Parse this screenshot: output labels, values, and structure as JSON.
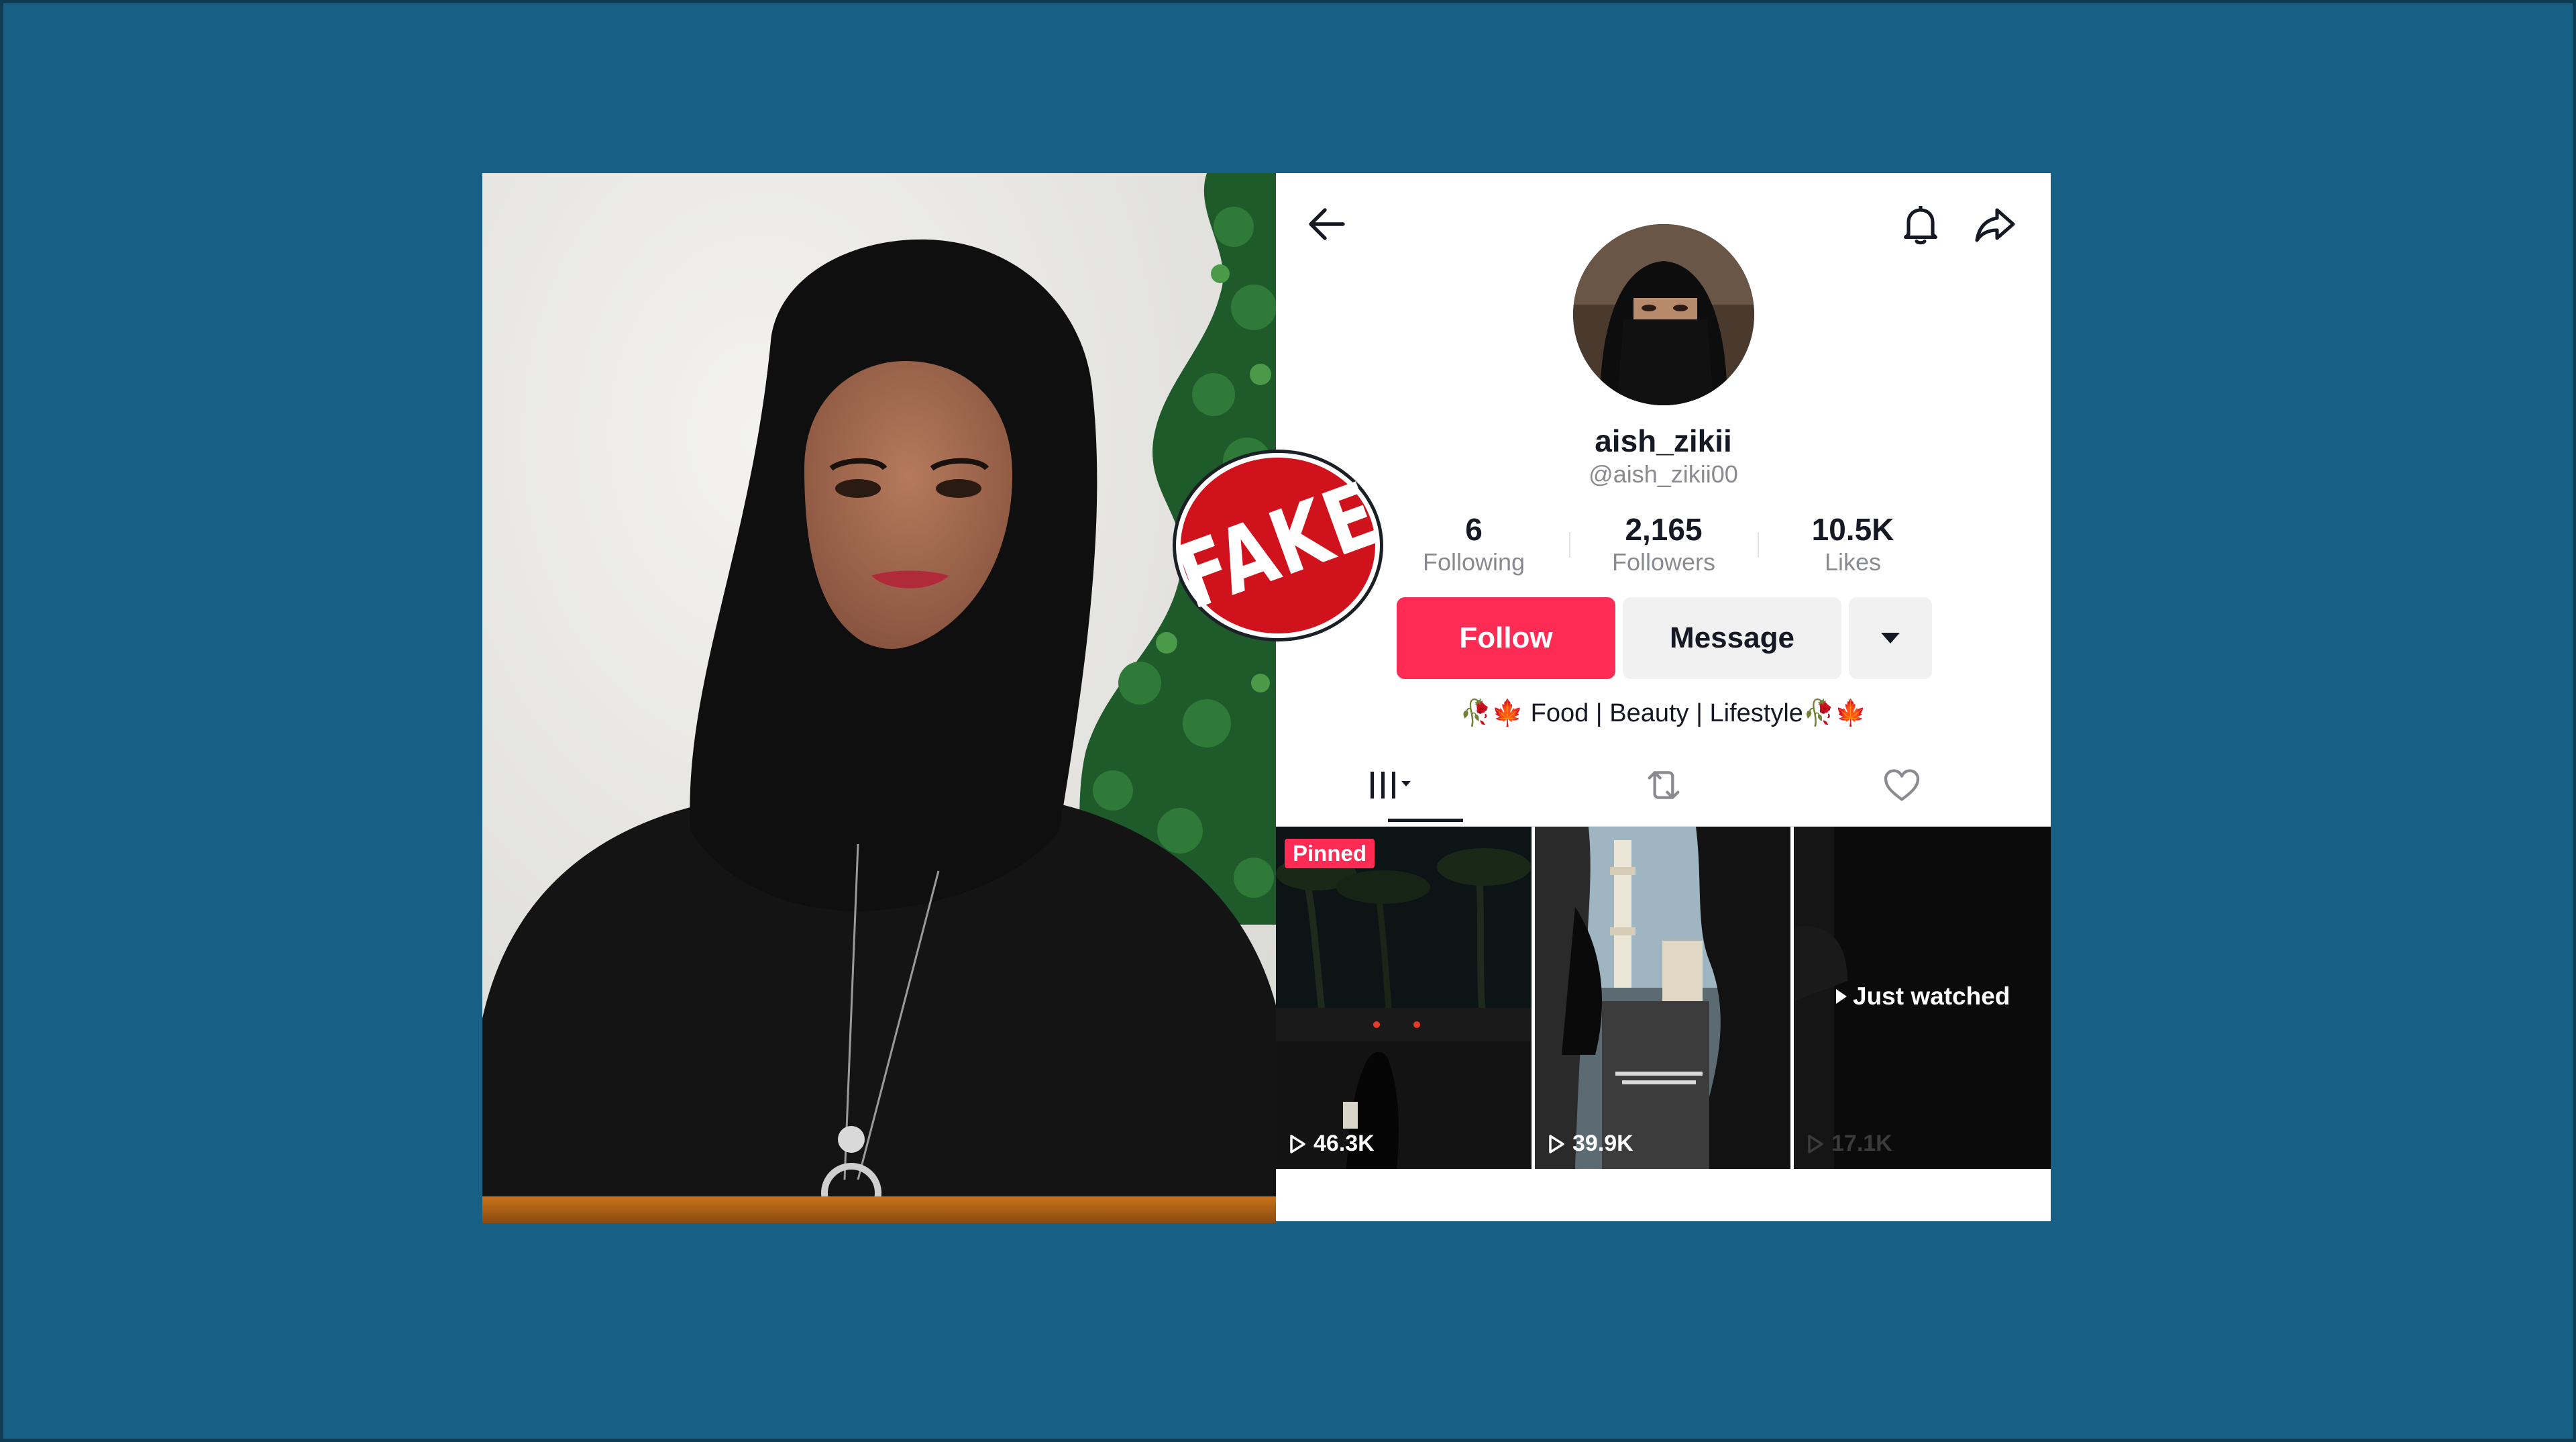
{
  "stamp": {
    "label": "FAKE",
    "color": "#d0121c"
  },
  "profile": {
    "back_icon": "arrow-left-icon",
    "bell_icon": "bell-icon",
    "share_icon": "share-icon",
    "username": "aish_zikii",
    "handle": "@aish_zikii00",
    "stats": [
      {
        "value": "6",
        "label": "Following"
      },
      {
        "value": "2,165",
        "label": "Followers"
      },
      {
        "value": "10.5K",
        "label": "Likes"
      }
    ],
    "buttons": {
      "follow": "Follow",
      "message": "Message",
      "more_icon": "caret-down-icon"
    },
    "bio": {
      "prefix_emoji": "🥀🍁",
      "text": " Food | Beauty | Lifestyle",
      "suffix_emoji": "🥀🍁"
    },
    "tabs": [
      {
        "name": "videos",
        "icon": "grid-bars-icon",
        "selected": true
      },
      {
        "name": "reposts",
        "icon": "repost-icon",
        "selected": false
      },
      {
        "name": "liked",
        "icon": "heart-icon",
        "selected": false
      }
    ],
    "videos": [
      {
        "badge": "Pinned",
        "views": "46.3K"
      },
      {
        "views": "39.9K"
      },
      {
        "overlay": "Just watched",
        "views": "17.1K"
      }
    ]
  },
  "colors": {
    "background": "#175f85",
    "follow_button": "#fe2c55",
    "secondary_button": "#f1f1f2",
    "text_primary": "#161823",
    "text_secondary": "#8a8b91"
  }
}
